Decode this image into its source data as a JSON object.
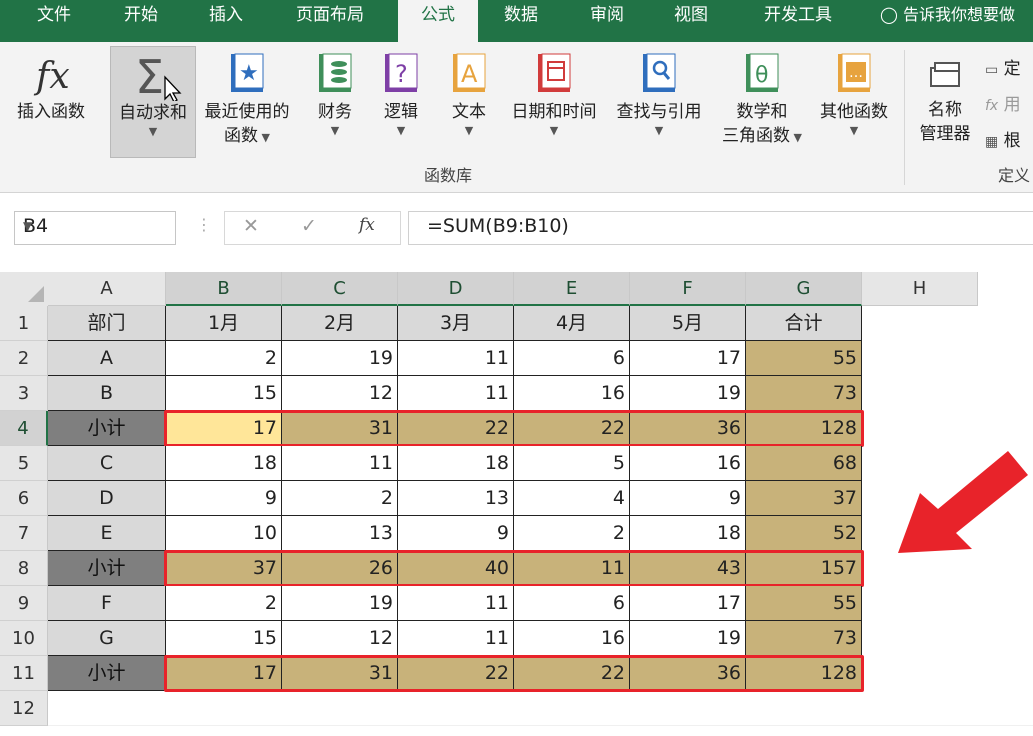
{
  "ribbon_tabs": [
    "文件",
    "开始",
    "插入",
    "页面布局",
    "公式",
    "数据",
    "审阅",
    "视图",
    "开发工具"
  ],
  "active_tab": "公式",
  "tell_me": "告诉我你想要做",
  "ribbon": {
    "insert_function": "插入函数",
    "autosum": "自动求和",
    "recent_1": "最近使用的",
    "recent_2": "函数",
    "financial": "财务",
    "logical": "逻辑",
    "text": "文本",
    "datetime": "日期和时间",
    "lookup": "查找与引用",
    "math_1": "数学和",
    "math_2": "三角函数",
    "more": "其他函数",
    "group_label": "函数库",
    "name_mgr_1": "名称",
    "name_mgr_2": "管理器",
    "define_name": "定",
    "use_in_formula": "用",
    "create_from_sel": "根",
    "defined_group": "定义"
  },
  "formula_bar": {
    "name_box": "B4",
    "formula": "=SUM(B9:B10)"
  },
  "columns": [
    "A",
    "B",
    "C",
    "D",
    "E",
    "F",
    "G",
    "H"
  ],
  "row_numbers": [
    "1",
    "2",
    "3",
    "4",
    "5",
    "6",
    "7",
    "8",
    "9",
    "10",
    "11",
    "12"
  ],
  "header_row": [
    "部门",
    "1月",
    "2月",
    "3月",
    "4月",
    "5月",
    "合计"
  ],
  "rows": [
    {
      "dept": "A",
      "vals": [
        "2",
        "19",
        "11",
        "6",
        "17"
      ],
      "total": "55",
      "subtotal": false
    },
    {
      "dept": "B",
      "vals": [
        "15",
        "12",
        "11",
        "16",
        "19"
      ],
      "total": "73",
      "subtotal": false
    },
    {
      "dept": "小计",
      "vals": [
        "17",
        "31",
        "22",
        "22",
        "36"
      ],
      "total": "128",
      "subtotal": true
    },
    {
      "dept": "C",
      "vals": [
        "18",
        "11",
        "18",
        "5",
        "16"
      ],
      "total": "68",
      "subtotal": false
    },
    {
      "dept": "D",
      "vals": [
        "9",
        "2",
        "13",
        "4",
        "9"
      ],
      "total": "37",
      "subtotal": false
    },
    {
      "dept": "E",
      "vals": [
        "10",
        "13",
        "9",
        "2",
        "18"
      ],
      "total": "52",
      "subtotal": false
    },
    {
      "dept": "小计",
      "vals": [
        "37",
        "26",
        "40",
        "11",
        "43"
      ],
      "total": "157",
      "subtotal": true
    },
    {
      "dept": "F",
      "vals": [
        "2",
        "19",
        "11",
        "6",
        "17"
      ],
      "total": "55",
      "subtotal": false
    },
    {
      "dept": "G",
      "vals": [
        "15",
        "12",
        "11",
        "16",
        "19"
      ],
      "total": "73",
      "subtotal": false
    },
    {
      "dept": "小计",
      "vals": [
        "17",
        "31",
        "22",
        "22",
        "36"
      ],
      "total": "128",
      "subtotal": true
    }
  ],
  "colors": {
    "excel_green": "#217346",
    "subtotal_fill": "#c8b27a",
    "highlight_red": "#e8232a",
    "active_cell": "#ffe699"
  }
}
